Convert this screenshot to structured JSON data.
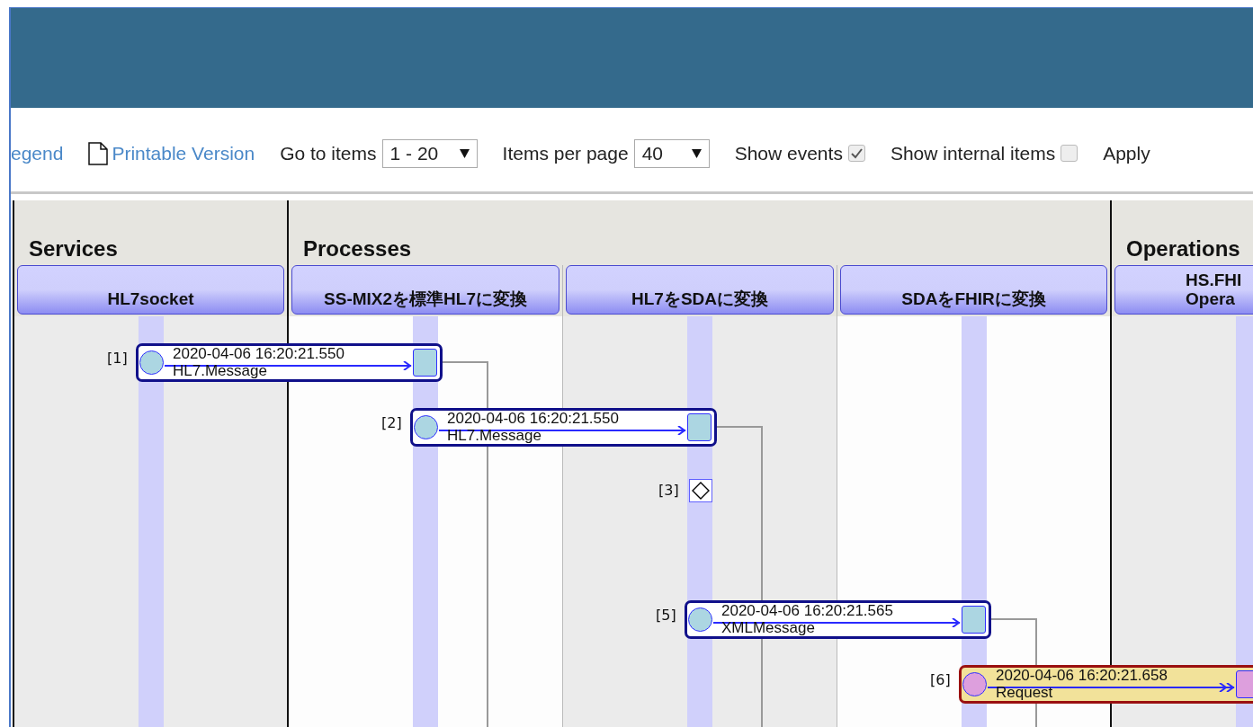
{
  "toolbar": {
    "links": [
      {
        "label": "egend",
        "kind": "link"
      },
      {
        "label": "Printable Version",
        "kind": "doc-link"
      }
    ],
    "go_to_items": {
      "label": "Go to items",
      "value": "1 - 20"
    },
    "items_per_page": {
      "label": "Items per page",
      "value": "40"
    },
    "checkboxes": [
      {
        "label": "Show events",
        "checked": true
      },
      {
        "label": "Show internal items",
        "checked": false
      }
    ],
    "apply": "Apply"
  },
  "diagram": {
    "groups": [
      {
        "title": "Services",
        "lanes": [
          {
            "lines": [
              "HL7socket"
            ]
          }
        ]
      },
      {
        "title": "Processes",
        "lanes": [
          {
            "lines": [
              "SS-MIX2を標準HL7に変換"
            ]
          },
          {
            "lines": [
              "HL7をSDAに変換"
            ]
          },
          {
            "lines": [
              "SDAをFHIRに変換"
            ]
          }
        ]
      },
      {
        "title": "Operations",
        "lanes": [
          {
            "lines": [
              "HS.FHI",
              "Opera"
            ]
          }
        ]
      }
    ],
    "items": [
      {
        "index": "[1]",
        "kind": "message",
        "time": "2020-04-06 16:20:21.550",
        "type": "HL7.Message"
      },
      {
        "index": "[2]",
        "kind": "message",
        "time": "2020-04-06 16:20:21.550",
        "type": "HL7.Message"
      },
      {
        "index": "[3]",
        "kind": "event"
      },
      {
        "index": "[5]",
        "kind": "message",
        "time": "2020-04-06 16:20:21.565",
        "type": "XMLMessage"
      },
      {
        "index": "[6]",
        "kind": "request",
        "time": "2020-04-06 16:20:21.658",
        "type": "Request"
      }
    ]
  }
}
